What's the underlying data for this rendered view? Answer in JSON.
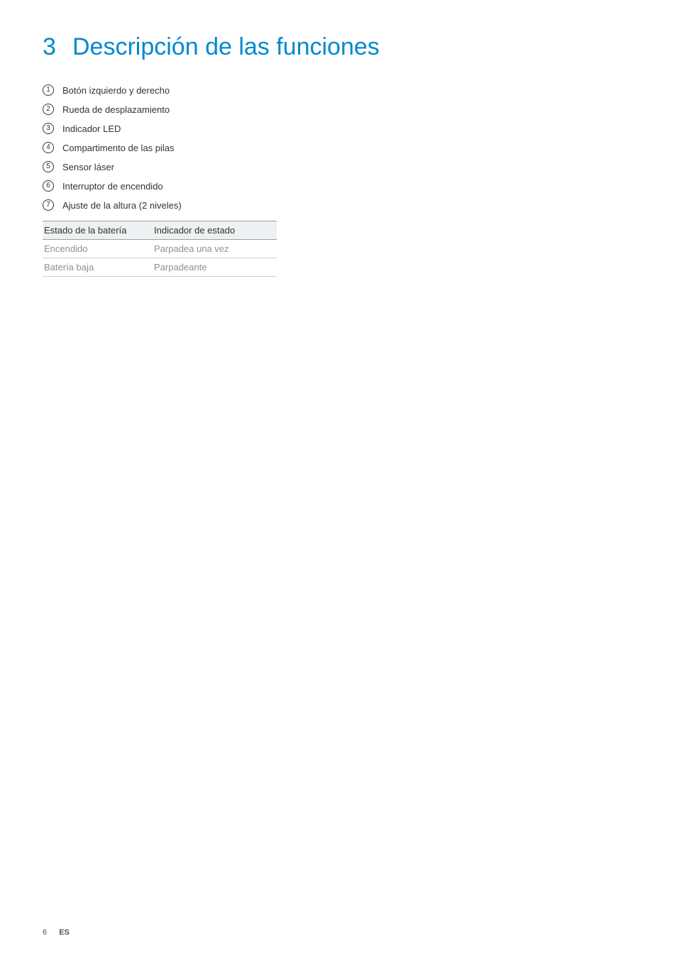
{
  "heading": {
    "number": "3",
    "title": "Descripción de las funciones"
  },
  "features": [
    {
      "num": "1",
      "label": "Botón izquierdo y derecho"
    },
    {
      "num": "2",
      "label": "Rueda de desplazamiento"
    },
    {
      "num": "3",
      "label": "Indicador LED"
    },
    {
      "num": "4",
      "label": "Compartimento de las pilas"
    },
    {
      "num": "5",
      "label": "Sensor láser"
    },
    {
      "num": "6",
      "label": "Interruptor de encendido"
    },
    {
      "num": "7",
      "label": "Ajuste de la altura (2 niveles)"
    }
  ],
  "table": {
    "headers": {
      "col1": "Estado de la batería",
      "col2": "Indicador de estado"
    },
    "rows": [
      {
        "col1": "Encendido",
        "col2": "Parpadea una vez"
      },
      {
        "col1": "Batería baja",
        "col2": "Parpadeante"
      }
    ]
  },
  "footer": {
    "page": "6",
    "lang": "ES"
  }
}
